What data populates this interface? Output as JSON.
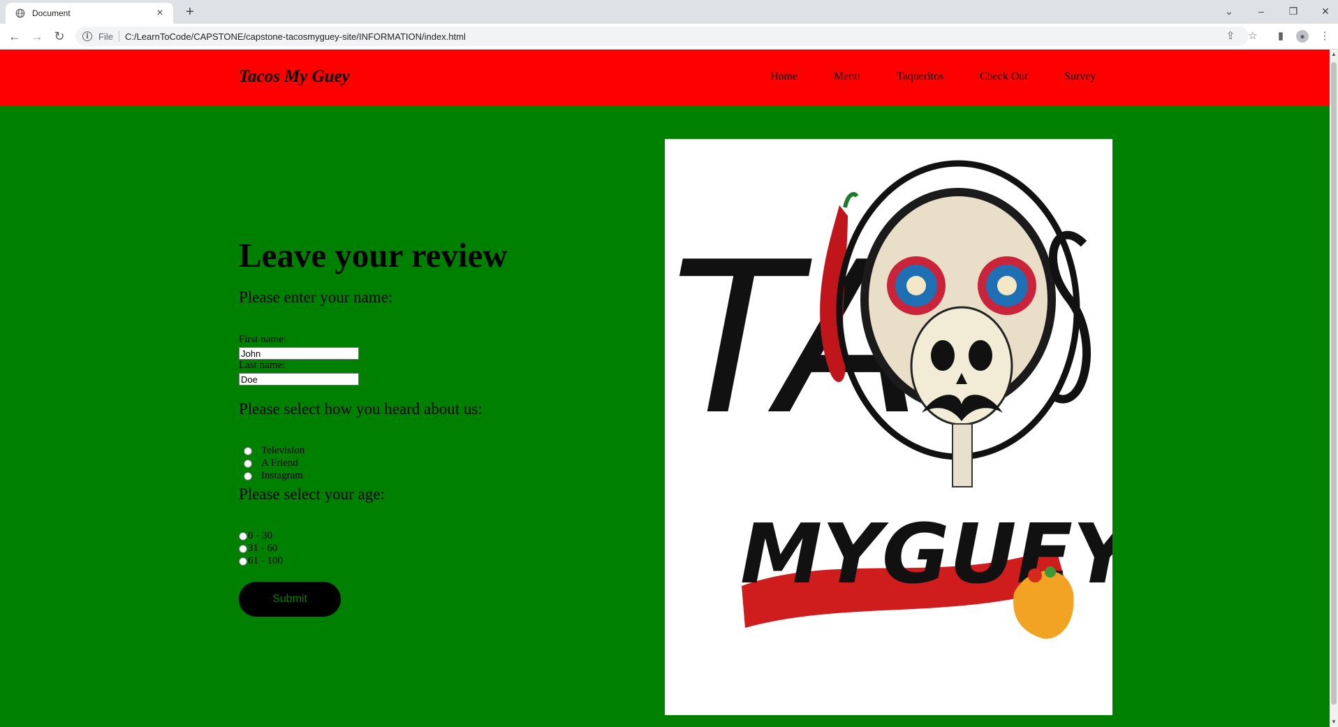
{
  "browser": {
    "tab_title": "Document",
    "tab_close": "×",
    "new_tab": "+",
    "back": "←",
    "forward": "→",
    "reload": "↻",
    "file_label": "File",
    "url": "C:/LearnToCode/CAPSTONE/capstone-tacosmyguey-site/INFORMATION/index.html",
    "info_glyph": "i",
    "tab_search": "⌄",
    "minimize": "–",
    "restore": "❐",
    "close": "✕",
    "share": "⇪",
    "bookmark": "☆",
    "side_panel": "▮",
    "profile": "●",
    "menu": "⋮"
  },
  "site": {
    "brand": "Tacos My Guey",
    "nav": [
      "Home",
      "Menu",
      "Taqueritos",
      "Check Out",
      "Survey"
    ]
  },
  "form": {
    "heading": "Leave your review",
    "name_prompt": "Please enter your name:",
    "first_label": "First name:",
    "first_value": "John",
    "last_label": "Last name:",
    "last_value": "Doe",
    "heard_prompt": "Please select how you heard about us:",
    "heard_options": [
      "Television",
      "A Friend",
      "Instagram"
    ],
    "age_prompt": "Please select your age:",
    "age_options": [
      "0 - 30",
      "31 - 60",
      "61 - 100"
    ],
    "submit": "Submit"
  },
  "logo": {
    "line1_left": "TA",
    "line1_right": "S",
    "line2": "MYGUEY"
  },
  "colors": {
    "header": "#ff0000",
    "body": "#008000",
    "button": "#000000",
    "button_text": "#008000"
  }
}
